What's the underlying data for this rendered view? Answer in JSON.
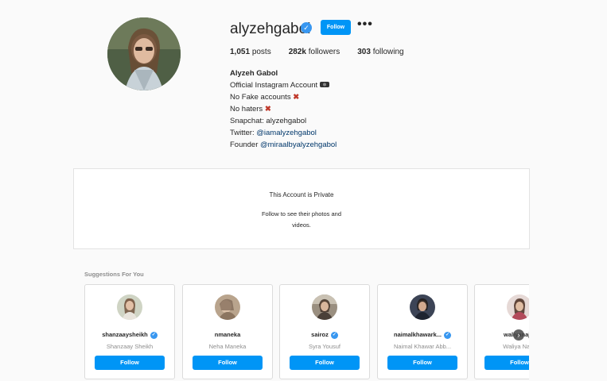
{
  "profile": {
    "username": "alyzehgabol",
    "follow_label": "Follow",
    "more_label": "•••",
    "posts_count": "1,051",
    "posts_label": "posts",
    "followers_count": "282k",
    "followers_label": "followers",
    "following_count": "303",
    "following_label": "following",
    "full_name": "Alyzeh Gabol",
    "bio_line1": "Official Instagram Account",
    "bio_line2": "No Fake accounts",
    "bio_line3": "No haters",
    "bio_line4": "Snapchat: alyzehgabol",
    "bio_line5_prefix": "Twitter: ",
    "bio_line5_link": "@iamalyzehgabol",
    "bio_line6_prefix": "Founder ",
    "bio_line6_link": "@miraalbyalyzehgabol",
    "cross_glyph": "✖",
    "verified_glyph": "✓"
  },
  "private": {
    "title": "This Account is Private",
    "subtitle": "Follow to see their photos and videos."
  },
  "suggestions": {
    "header": "Suggestions For You",
    "next_glyph": "›",
    "items": [
      {
        "username": "shanzaaysheikh",
        "name": "Shanzaay Sheikh",
        "verified": true,
        "follow": "Follow"
      },
      {
        "username": "nmaneka",
        "name": "Neha Maneka",
        "verified": false,
        "follow": "Follow"
      },
      {
        "username": "sairoz",
        "name": "Syra Yousuf",
        "verified": true,
        "follow": "Follow"
      },
      {
        "username": "naimalkhawark...",
        "name": "Naimal Khawar Abb...",
        "verified": true,
        "follow": "Follow"
      },
      {
        "username": "waliyanajib",
        "name": "Waliya Najib",
        "verified": false,
        "follow": "Follow"
      }
    ]
  }
}
